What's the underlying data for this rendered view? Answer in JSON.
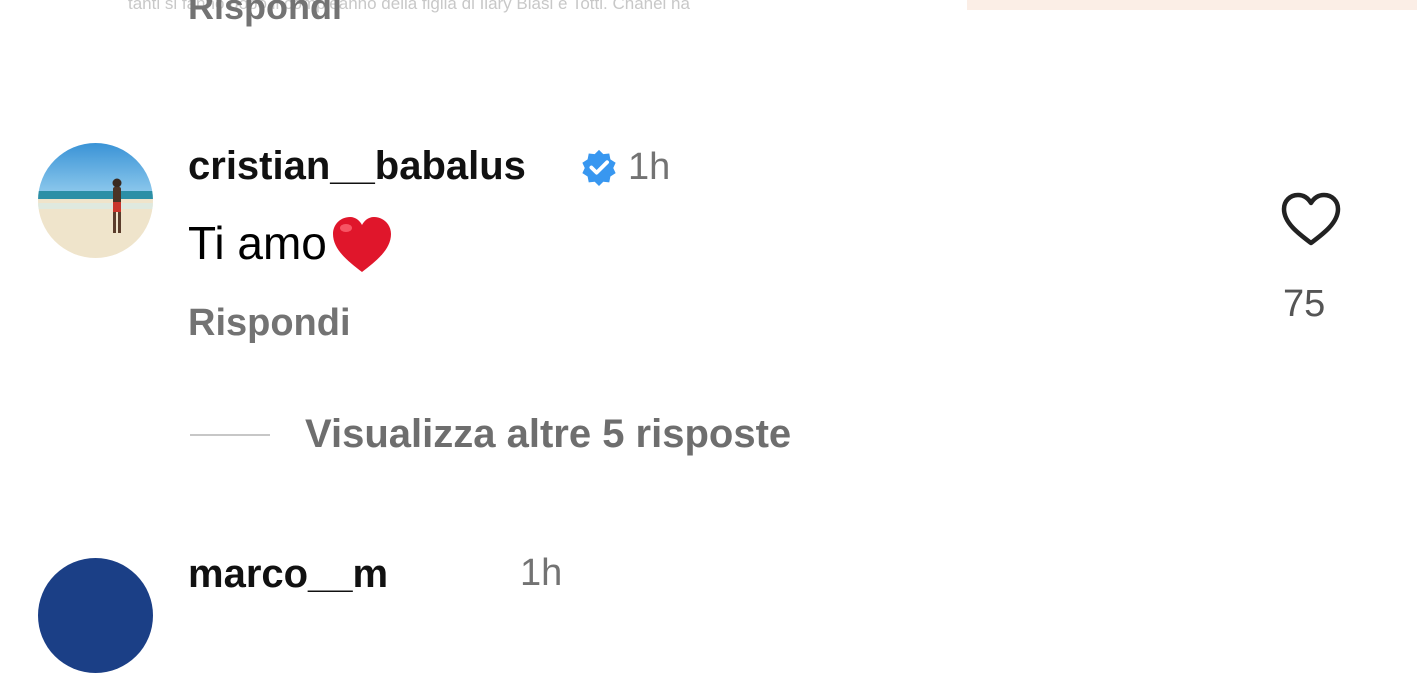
{
  "overlay_caption": "tanti si fanno dopo il compleanno della figlia di Ilary Blasi e Totti. Chanel ha",
  "previous_comment": {
    "reply_label": "Rispondi"
  },
  "comment": {
    "avatar_icon": "beach-photo-avatar",
    "username": "cristian__babalus",
    "verified_icon": "verified-badge-icon",
    "time": "1h",
    "text": "Ti amo",
    "emoji_icon": "red-heart-emoji",
    "reply_label": "Rispondi",
    "like_icon": "heart-outline-icon",
    "like_count": "75",
    "view_more_label": "Visualizza altre 5 risposte"
  },
  "next_comment": {
    "username": "marco__m",
    "time": "1h"
  },
  "colors": {
    "verified": "#3897f0",
    "emoji_red": "#e0162b",
    "secondary_text": "#737373"
  }
}
